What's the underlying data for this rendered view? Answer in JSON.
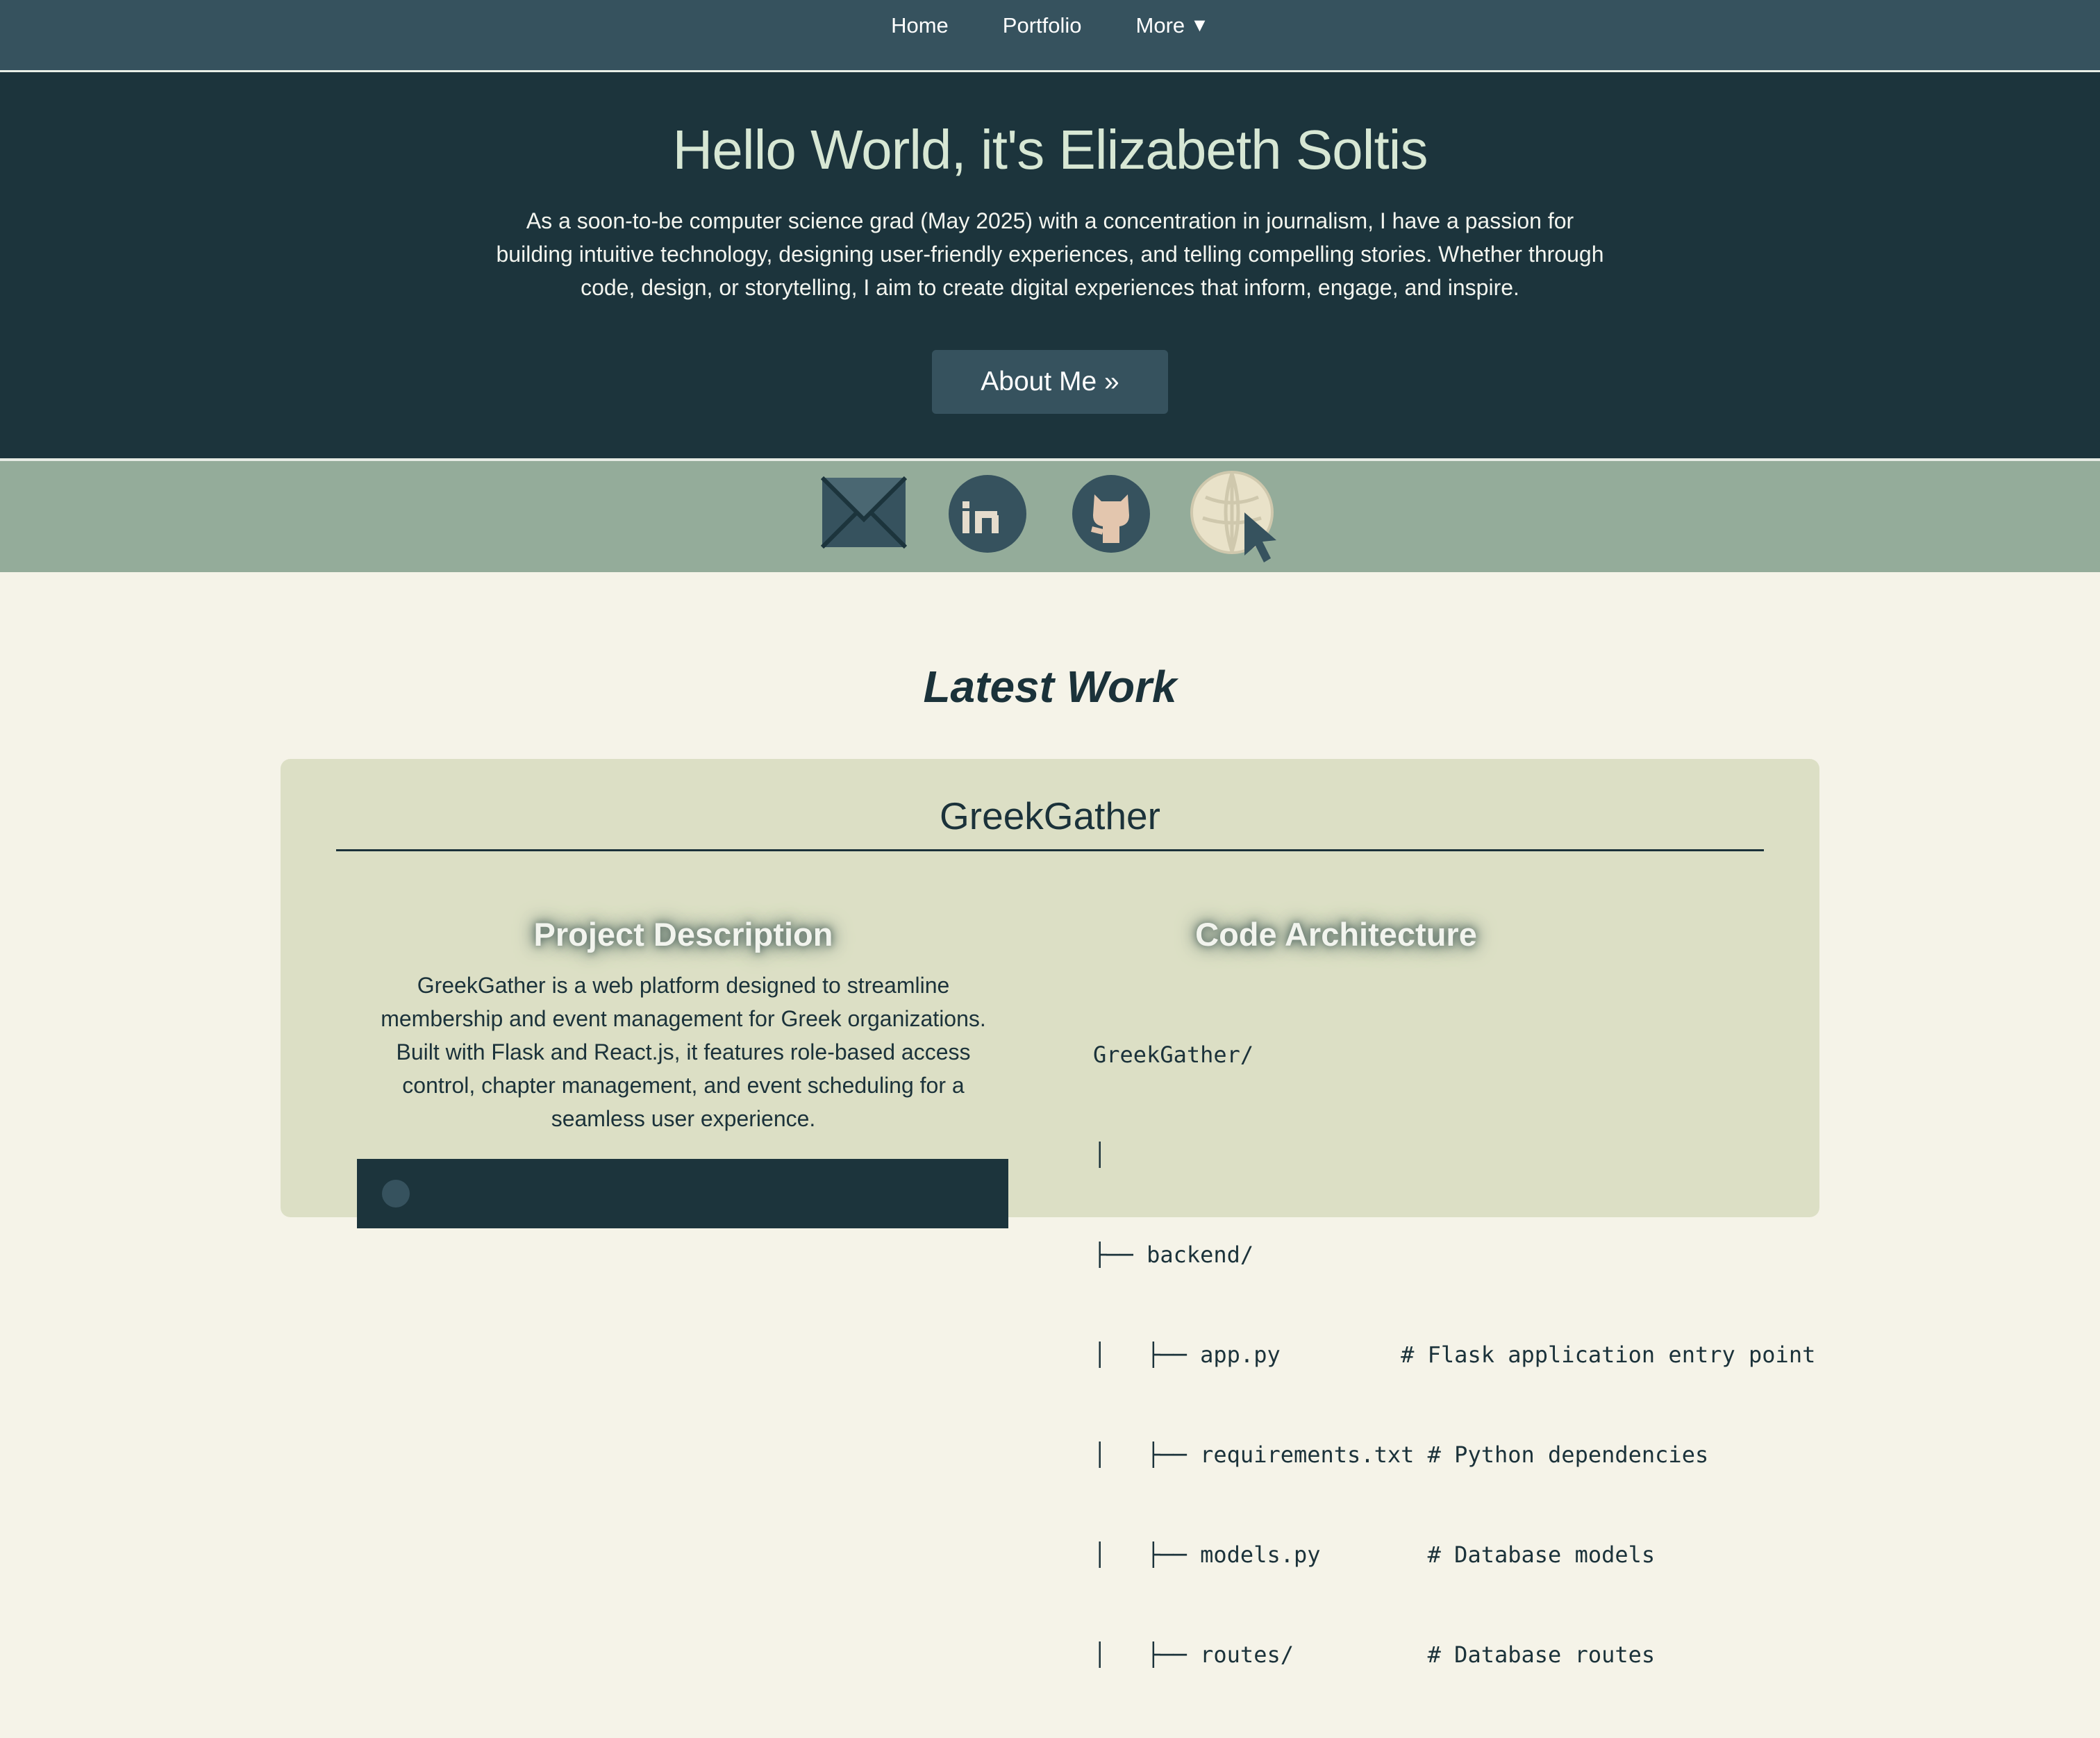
{
  "nav": {
    "items": [
      {
        "label": "Home"
      },
      {
        "label": "Portfolio"
      },
      {
        "label": "More"
      }
    ],
    "more_caret": "▼"
  },
  "hero": {
    "title": "Hello World, it's Elizabeth Soltis",
    "description": "As a soon-to-be computer science grad (May 2025) with a concentration in journalism, I have a passion for building intuitive technology, designing user-friendly experiences, and telling compelling stories. Whether through code, design, or storytelling, I aim to create digital experiences that inform, engage, and inspire.",
    "button_label": "About Me »"
  },
  "social": {
    "icons": [
      "email-icon",
      "linkedin-icon",
      "github-icon",
      "website-icon"
    ]
  },
  "latest_work": {
    "title": "Latest Work",
    "project": {
      "name": "GreekGather",
      "description_heading": "Project Description",
      "description": "GreekGather is a web platform designed to streamline membership and event management for Greek organizations. Built with Flask and React.js, it features role-based access control, chapter management, and event scheduling for a seamless user experience.",
      "architecture_heading": "Code Architecture",
      "architecture_lines": [
        "GreekGather/",
        "│",
        "├── backend/",
        "│   ├── app.py         # Flask application entry point",
        "│   ├── requirements.txt # Python dependencies",
        "│   ├── models.py        # Database models",
        "│   ├── routes/          # Database routes"
      ]
    }
  },
  "colors": {
    "nav_bg": "#36525e",
    "hero_bg": "#1c343c",
    "hero_title": "#d7e7d4",
    "social_bg": "#94ac9a",
    "page_bg": "#f5f3e8",
    "card_bg": "#dcdfc5",
    "text_dark": "#1b323a"
  }
}
